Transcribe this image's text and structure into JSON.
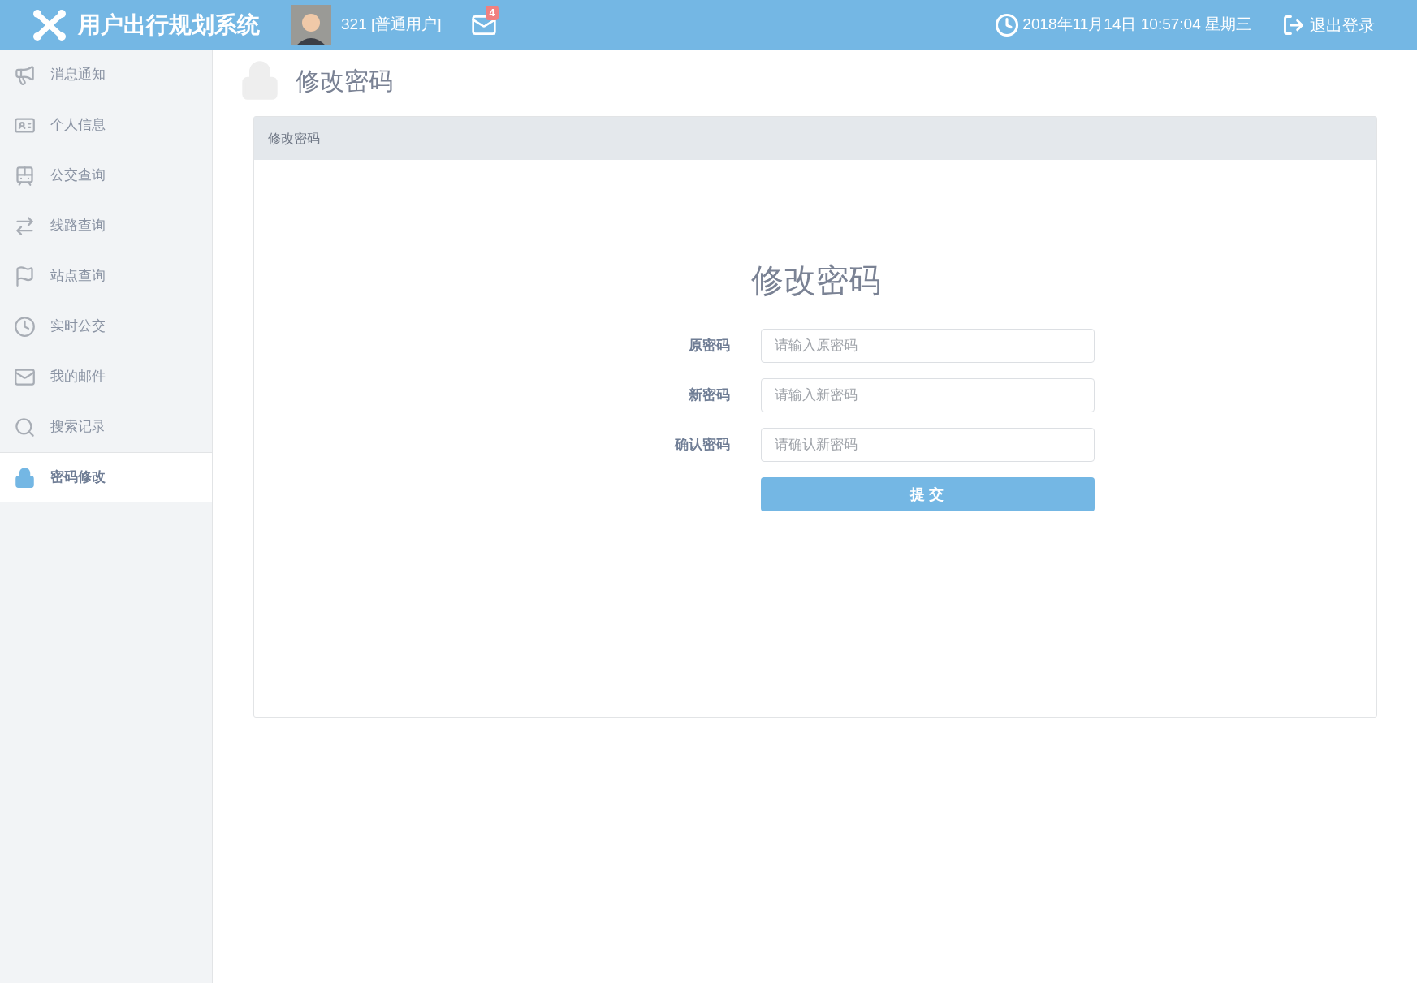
{
  "header": {
    "title": "用户出行规划系统",
    "user": "321 [普通用户]",
    "mail_badge": "4",
    "datetime": "2018年11月14日 10:57:04 星期三",
    "logout": "退出登录"
  },
  "sidebar": {
    "items": [
      {
        "label": "消息通知",
        "selected": false
      },
      {
        "label": "个人信息",
        "selected": false
      },
      {
        "label": "公交查询",
        "selected": false
      },
      {
        "label": "线路查询",
        "selected": false
      },
      {
        "label": "站点查询",
        "selected": false
      },
      {
        "label": "实时公交",
        "selected": false
      },
      {
        "label": "我的邮件",
        "selected": false
      },
      {
        "label": "搜索记录",
        "selected": false
      },
      {
        "label": "密码修改",
        "selected": true
      }
    ]
  },
  "page": {
    "title": "修改密码"
  },
  "panel": {
    "heading": "修改密码",
    "form_title": "修改密码",
    "fields": [
      {
        "label": "原密码",
        "placeholder": "请输入原密码"
      },
      {
        "label": "新密码",
        "placeholder": "请输入新密码"
      },
      {
        "label": "确认密码",
        "placeholder": "请确认新密码"
      }
    ],
    "submit": "提 交"
  }
}
